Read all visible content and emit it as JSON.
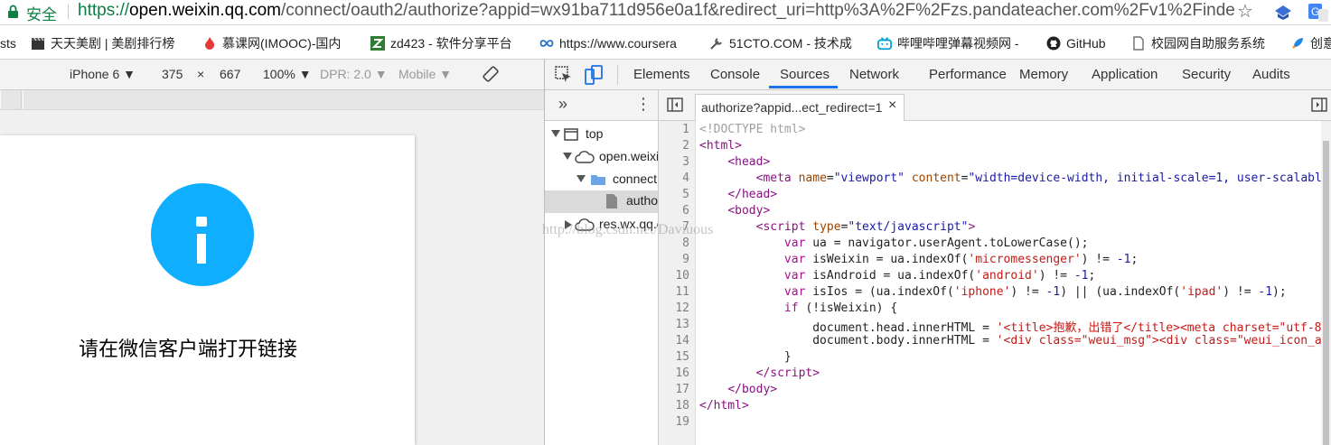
{
  "browser": {
    "secure_label": "安全",
    "url_scheme": "https://",
    "url_host": "open.weixin.qq.com",
    "url_rest": "/connect/oauth2/authorize?appid=wx91ba711d956e0a1f&redirect_uri=http%3A%2F%2Fzs.pandateacher.com%2Fv1%2Finde",
    "star_icon": "star-icon"
  },
  "bookmarks": [
    {
      "label": "sts",
      "icon": "none"
    },
    {
      "label": "天天美剧 | 美剧排行榜",
      "icon": "clapper-icon"
    },
    {
      "label": "慕课网(IMOOC)-国内",
      "icon": "flame-icon"
    },
    {
      "label": "zd423 - 软件分享平台",
      "icon": "z-icon"
    },
    {
      "label": "https://www.coursera",
      "icon": "infinity-icon"
    },
    {
      "label": "51CTO.COM - 技术成",
      "icon": "tool-icon"
    },
    {
      "label": "哔哩哔哩弹幕视频网 -",
      "icon": "tv-icon"
    },
    {
      "label": "GitHub",
      "icon": "github-icon"
    },
    {
      "label": "校园网自助服务系统",
      "icon": "doc-icon"
    },
    {
      "label": "创意",
      "icon": "rocket-icon"
    }
  ],
  "device_toolbar": {
    "device": "iPhone 6 ▼",
    "width": "375",
    "times": "×",
    "height": "667",
    "zoom": "100% ▼",
    "dpr": "DPR: 2.0 ▼",
    "mode": "Mobile ▼"
  },
  "page": {
    "message": "请在微信客户端打开链接"
  },
  "devtools": {
    "tabs": [
      "Elements",
      "Console",
      "Sources",
      "Network",
      "Performance",
      "Memory",
      "Application",
      "Security",
      "Audits"
    ],
    "active_tab": "Sources",
    "navigator": {
      "more": "»",
      "menu": "⋮",
      "items": [
        {
          "label": "top",
          "icon": "frame-icon"
        },
        {
          "label": "open.weixin.qq.com",
          "icon": "cloud-icon"
        },
        {
          "label": "connect",
          "icon": "folder-icon"
        },
        {
          "label": "authorize",
          "icon": "file-icon"
        },
        {
          "label": "res.wx.qq.com",
          "icon": "cloud-icon"
        }
      ]
    },
    "open_file": "authorize?appid...ect_redirect=1",
    "close_label": "×",
    "code_lines": [
      "1",
      "2",
      "3",
      "4",
      "5",
      "6",
      "7",
      "8",
      "9",
      "10",
      "11",
      "12",
      "13",
      "14",
      "15",
      "16",
      "17",
      "18",
      "19"
    ]
  },
  "watermark": "http://blog.csdn.net/Daviuous"
}
